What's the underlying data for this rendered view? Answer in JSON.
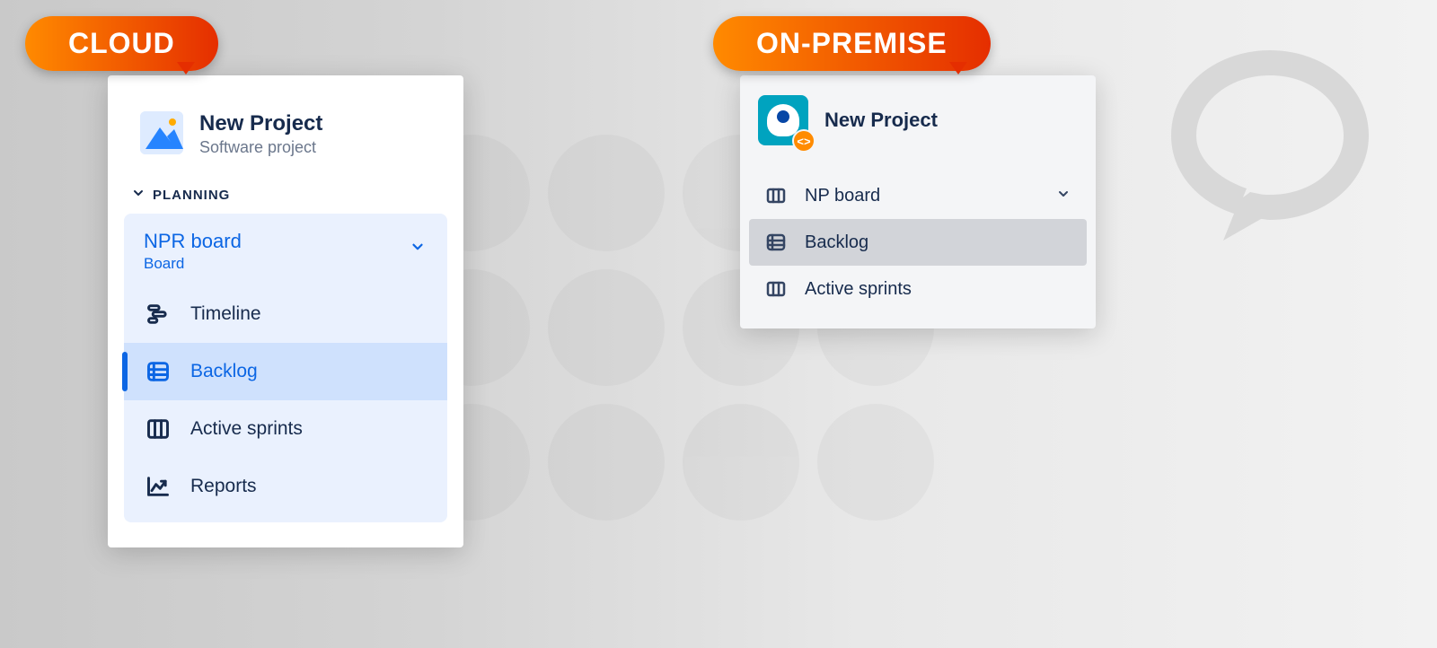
{
  "badges": {
    "cloud": "CLOUD",
    "onprem": "ON-PREMISE"
  },
  "cloud": {
    "project_title": "New Project",
    "project_subtitle": "Software project",
    "section_label": "PLANNING",
    "board": {
      "name": "NPR board",
      "sub": "Board"
    },
    "items": [
      {
        "label": "Timeline",
        "icon": "timeline-icon",
        "selected": false
      },
      {
        "label": "Backlog",
        "icon": "backlog-icon",
        "selected": true
      },
      {
        "label": "Active sprints",
        "icon": "board-icon",
        "selected": false
      },
      {
        "label": "Reports",
        "icon": "reports-icon",
        "selected": false
      }
    ]
  },
  "onprem": {
    "project_title": "New Project",
    "board_name": "NP board",
    "items": [
      {
        "label": "Backlog",
        "icon": "backlog-icon",
        "selected": true
      },
      {
        "label": "Active sprints",
        "icon": "board-icon",
        "selected": false
      }
    ]
  }
}
